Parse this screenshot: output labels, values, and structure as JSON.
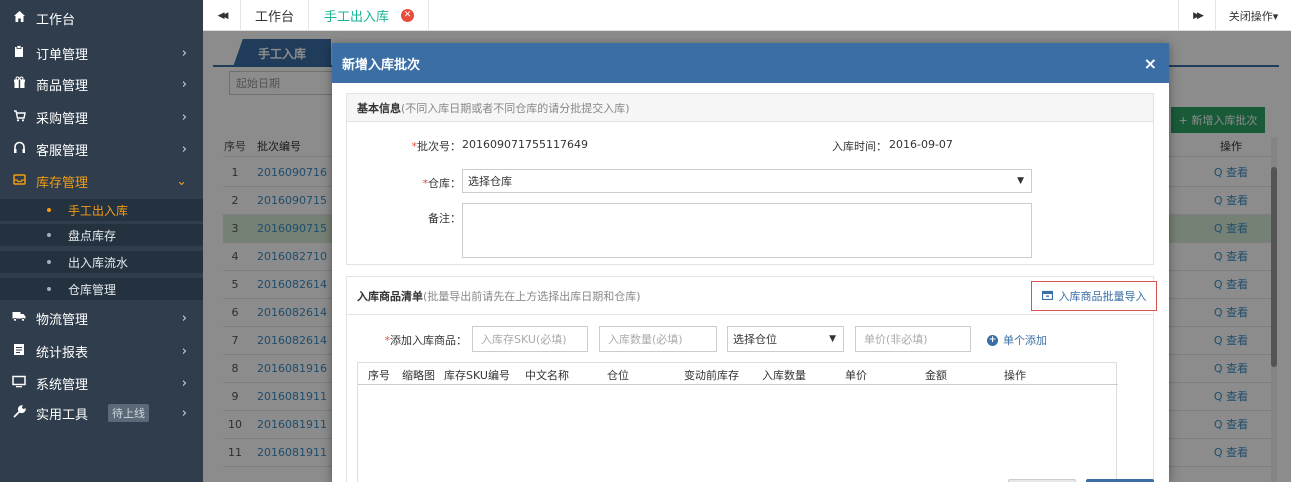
{
  "sidebar": {
    "items": [
      {
        "label": "工作台",
        "icon": "home-icon",
        "glyph": "🏠",
        "has_arrow": false
      },
      {
        "label": "订单管理",
        "icon": "clipboard-icon",
        "glyph": "▮",
        "has_arrow": true
      },
      {
        "label": "商品管理",
        "icon": "gift-icon",
        "glyph": "✿",
        "has_arrow": true
      },
      {
        "label": "采购管理",
        "icon": "cart-icon",
        "glyph": "⊞",
        "has_arrow": true
      },
      {
        "label": "客服管理",
        "icon": "headset-icon",
        "glyph": "∩",
        "has_arrow": true
      },
      {
        "label": "库存管理",
        "icon": "inbox-icon",
        "glyph": "⊟",
        "has_arrow": true,
        "expanded": true
      }
    ],
    "sub_items": [
      {
        "label": "手工出入库",
        "active": true
      },
      {
        "label": "盘点库存",
        "active": false
      },
      {
        "label": "出入库流水",
        "active": false
      },
      {
        "label": "仓库管理",
        "active": false
      }
    ],
    "items_after": [
      {
        "label": "物流管理",
        "icon": "truck-icon",
        "glyph": "⛟",
        "has_arrow": true
      },
      {
        "label": "统计报表",
        "icon": "report-icon",
        "glyph": "▤",
        "has_arrow": true
      },
      {
        "label": "系统管理",
        "icon": "monitor-icon",
        "glyph": "▭",
        "has_arrow": true
      },
      {
        "label": "实用工具",
        "icon": "wrench-icon",
        "glyph": "✎",
        "has_arrow": true,
        "badge": "待上线"
      }
    ],
    "arrow_glyph": "›",
    "down_glyph": "⌄"
  },
  "tabbar": {
    "back_glyph": "◀◀",
    "forward_glyph": "▶▶",
    "tabs": [
      {
        "label": "工作台",
        "active": false
      },
      {
        "label": "手工出入库",
        "active": true
      }
    ],
    "close_ops_label": "关闭操作▾"
  },
  "page": {
    "tab_label": "手工入库",
    "date_placeholder": "起始日期",
    "add_batch_label": "+ 新增入库批次",
    "table_headers": {
      "no": "序号",
      "code": "批次编号",
      "op": "操作"
    },
    "rows": [
      {
        "no": "1",
        "code": "2016090716",
        "op": "Q 查看"
      },
      {
        "no": "2",
        "code": "2016090715",
        "op": "Q 查看"
      },
      {
        "no": "3",
        "code": "2016090715",
        "op": "Q 查看",
        "highlight": true
      },
      {
        "no": "4",
        "code": "2016082710",
        "op": "Q 查看"
      },
      {
        "no": "5",
        "code": "2016082614",
        "op": "Q 查看"
      },
      {
        "no": "6",
        "code": "2016082614",
        "op": "Q 查看"
      },
      {
        "no": "7",
        "code": "2016082614",
        "op": "Q 查看"
      },
      {
        "no": "8",
        "code": "2016081916",
        "op": "Q 查看"
      },
      {
        "no": "9",
        "code": "2016081911",
        "op": "Q 查看"
      },
      {
        "no": "10",
        "code": "2016081911",
        "op": "Q 查看"
      },
      {
        "no": "11",
        "code": "2016081911",
        "op": "Q 查看"
      }
    ]
  },
  "modal": {
    "title": "新增入库批次",
    "close_glyph": "×",
    "basic": {
      "title": "基本信息",
      "note": "(不同入库日期或者不同仓库的请分批提交入库)",
      "batch_label": "批次号：",
      "batch_value": "201609071755117649",
      "time_label": "入库时间：",
      "time_value": "2016-09-07",
      "warehouse_label": "仓库：",
      "warehouse_value": "选择仓库",
      "remark_label": "备注："
    },
    "items": {
      "title": "入库商品清单",
      "note": "(批量导出前请先在上方选择出库日期和仓库)",
      "import_label": "入库商品批量导入",
      "add_label": "添加入库商品：",
      "sku_placeholder": "入库存SKU(必填)",
      "qty_placeholder": "入库数量(必填)",
      "location_value": "选择仓位",
      "price_placeholder": "单价(非必填)",
      "add_single_label": "单个添加",
      "columns": [
        "序号",
        "缩略图",
        "库存SKU编号",
        "中文名称",
        "仓位",
        "变动前库存",
        "入库数量",
        "单价",
        "金额",
        "操作"
      ]
    }
  },
  "colors": {
    "sidebar_bg": "#2f3d4c",
    "accent_orange": "#f39c12",
    "primary_blue": "#3a6ea5",
    "link_blue": "#3b8ec6",
    "green": "#2ea568",
    "danger": "#e74c3c"
  }
}
